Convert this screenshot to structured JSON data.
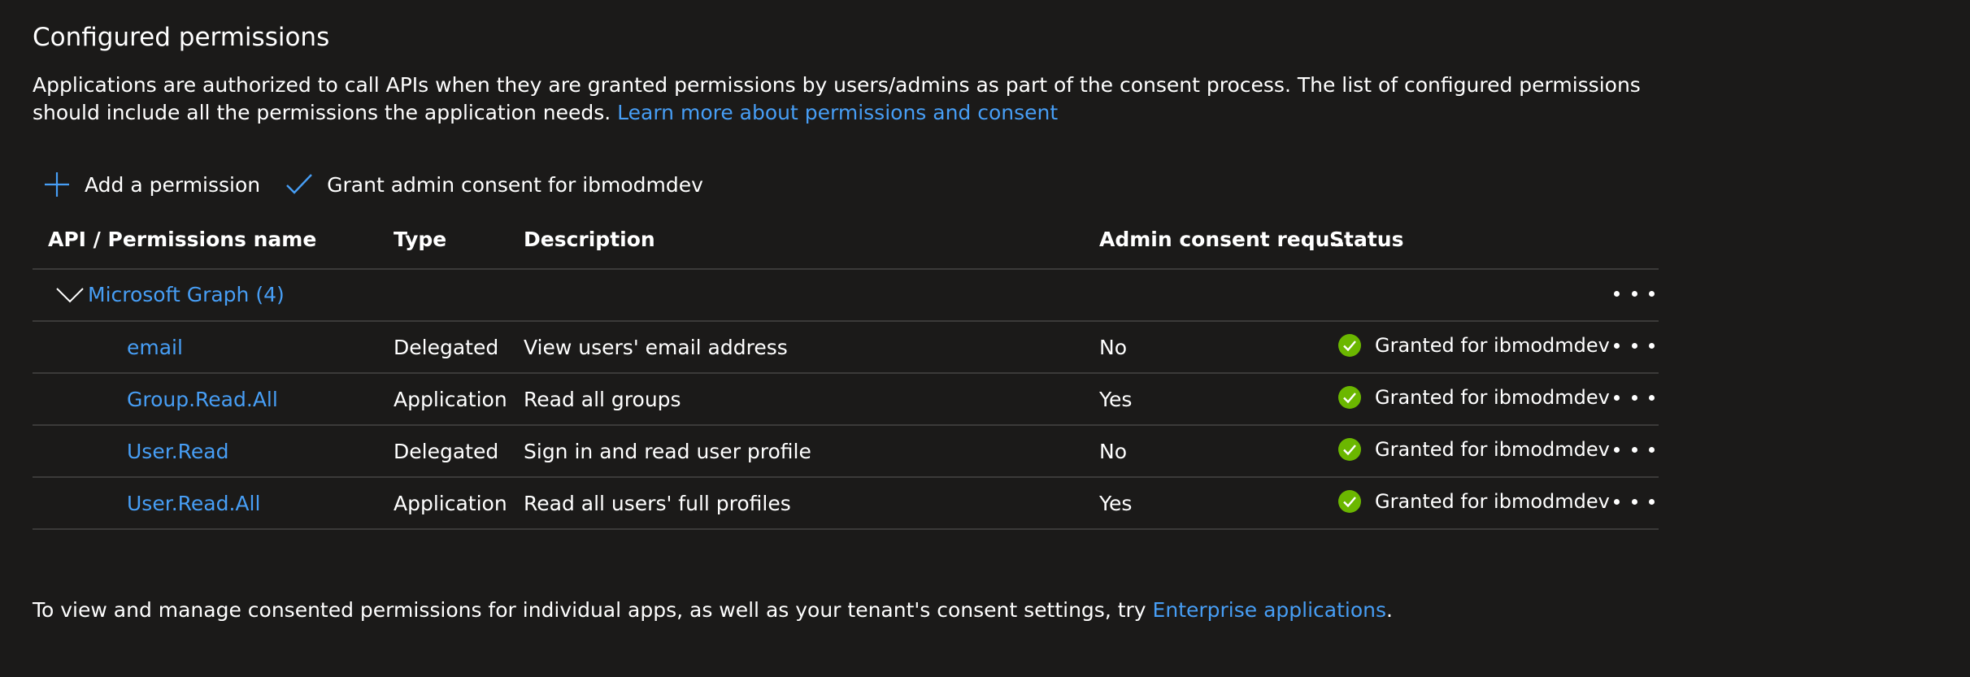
{
  "section": {
    "title": "Configured permissions",
    "description": "Applications are authorized to call APIs when they are granted permissions by users/admins as part of the consent process. The list of configured permissions should include all the permissions the application needs.",
    "learn_more_link": "Learn more about permissions and consent"
  },
  "toolbar": {
    "add_label": "Add a permission",
    "grant_label": "Grant admin consent for ibmodmdev"
  },
  "table": {
    "headers": {
      "name": "API / Permissions name",
      "type": "Type",
      "description": "Description",
      "admin": "Admin consent requ...",
      "status": "Status"
    },
    "group": {
      "label": "Microsoft Graph (4)"
    },
    "rows": [
      {
        "name": "email",
        "type": "Delegated",
        "description": "View users' email address",
        "admin": "No",
        "status": "Granted for ibmodmdev"
      },
      {
        "name": "Group.Read.All",
        "type": "Application",
        "description": "Read all groups",
        "admin": "Yes",
        "status": "Granted for ibmodmdev"
      },
      {
        "name": "User.Read",
        "type": "Delegated",
        "description": "Sign in and read user profile",
        "admin": "No",
        "status": "Granted for ibmodmdev"
      },
      {
        "name": "User.Read.All",
        "type": "Application",
        "description": "Read all users' full profiles",
        "admin": "Yes",
        "status": "Granted for ibmodmdev"
      }
    ]
  },
  "footer": {
    "text": "To view and manage consented permissions for individual apps, as well as your tenant's consent settings, try ",
    "link": "Enterprise applications",
    "end": "."
  },
  "colors": {
    "background": "#1b1a19",
    "link": "#479ef5",
    "success": "#6bb700",
    "divider": "#3b3a39"
  },
  "icons": {
    "add": "plus-icon",
    "grant": "checkmark-icon",
    "expand": "chevron-down-icon",
    "status": "success-check-icon",
    "more": "more-ellipsis-icon"
  }
}
